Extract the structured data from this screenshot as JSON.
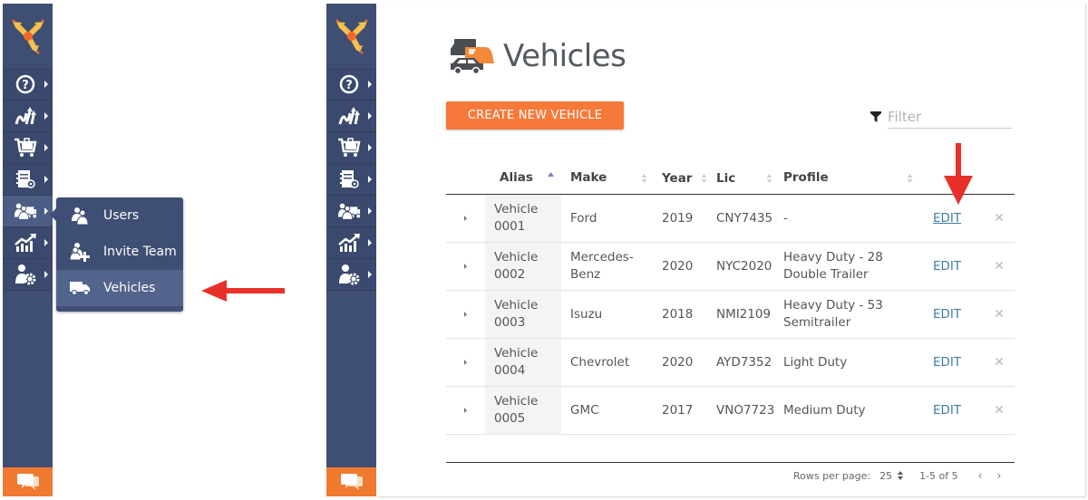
{
  "sidebar": {
    "items": [
      {
        "icon": "help-circle-icon"
      },
      {
        "icon": "routes-icon"
      },
      {
        "icon": "cart-icon"
      },
      {
        "icon": "address-book-icon"
      },
      {
        "icon": "team-vehicles-icon"
      },
      {
        "icon": "analytics-icon"
      },
      {
        "icon": "user-settings-icon"
      }
    ],
    "active_index": 4,
    "chat_icon": "chat-bubbles-icon"
  },
  "flyout": {
    "items": [
      {
        "label": "Users",
        "icon": "users-icon"
      },
      {
        "label": "Invite Team",
        "icon": "invite-user-icon"
      },
      {
        "label": "Vehicles",
        "icon": "truck-icon"
      }
    ],
    "active_label": "Vehicles"
  },
  "page": {
    "title": "Vehicles",
    "create_button": "CREATE NEW VEHICLE",
    "filter_placeholder": "Filter",
    "filter_value": ""
  },
  "table": {
    "columns": [
      {
        "label": "Alias",
        "sort": "asc"
      },
      {
        "label": "Make",
        "sort": "none"
      },
      {
        "label": "Year",
        "sort": "none"
      },
      {
        "label": "Lic",
        "sort": "none"
      },
      {
        "label": "Profile",
        "sort": "none"
      }
    ],
    "edit_label": "EDIT",
    "delete_symbol": "✕",
    "rows": [
      {
        "alias": "Vehicle 0001",
        "make": "Ford",
        "year": "2019",
        "lic": "CNY7435",
        "profile": "-"
      },
      {
        "alias": "Vehicle 0002",
        "make": "Mercedes-Benz",
        "year": "2020",
        "lic": "NYC2020",
        "profile": "Heavy Duty - 28 Double Trailer"
      },
      {
        "alias": "Vehicle 0003",
        "make": "Isuzu",
        "year": "2018",
        "lic": "NMI2109",
        "profile": "Heavy Duty - 53 Semitrailer"
      },
      {
        "alias": "Vehicle 0004",
        "make": "Chevrolet",
        "year": "2020",
        "lic": "AYD7352",
        "profile": "Light Duty"
      },
      {
        "alias": "Vehicle 0005",
        "make": "GMC",
        "year": "2017",
        "lic": "VNO7723",
        "profile": "Medium Duty"
      }
    ]
  },
  "pagination": {
    "rows_per_page_label": "Rows per page:",
    "rows_per_page": "25",
    "range": "1-5 of 5",
    "prev": "‹",
    "next": "›"
  },
  "colors": {
    "sidebar": "#3f4e73",
    "accent_orange": "#f6793a",
    "link_blue": "#3a7ea4",
    "annotation_red": "#e8302a"
  }
}
